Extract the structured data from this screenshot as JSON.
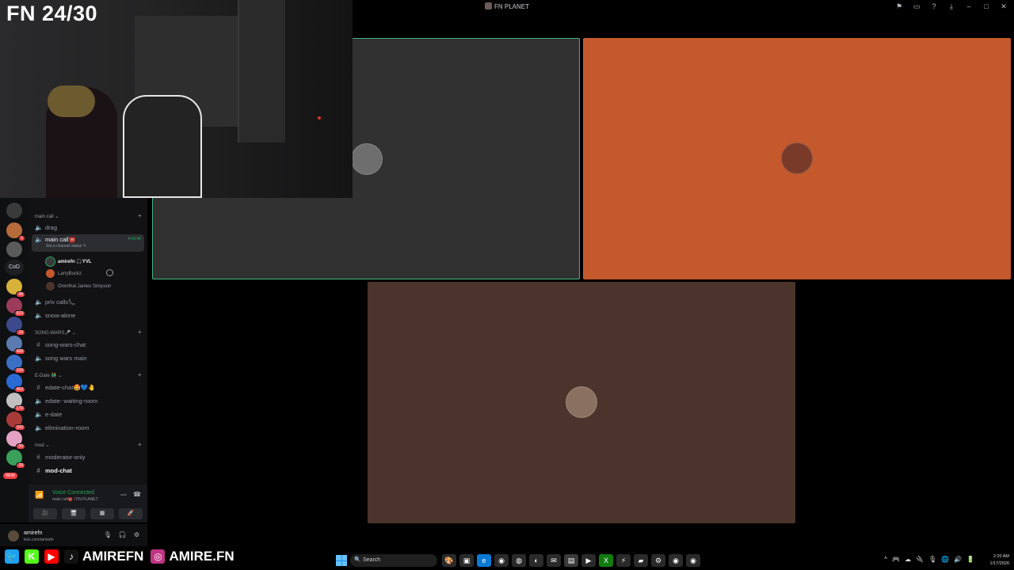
{
  "window": {
    "title": "FN PLANET",
    "controls": [
      "⚑",
      "▭",
      "?",
      "⤓",
      "–",
      "□",
      "✕"
    ]
  },
  "overlay": {
    "counter": "FN 24/30"
  },
  "guilds": [
    {
      "color": "#3a3a3a",
      "badge": ""
    },
    {
      "color": "#b56b3a",
      "badge": "1"
    },
    {
      "color": "#5b5b5b",
      "badge": ""
    },
    {
      "text": "CoD"
    },
    {
      "color": "#d7b23a",
      "badge": "46"
    },
    {
      "color": "#9c3b5a",
      "badge": "823"
    },
    {
      "color": "#3b4a8c",
      "badge": "10"
    },
    {
      "color": "#5a7ab0",
      "badge": "489"
    },
    {
      "color": "#3a6fc4",
      "badge": "169"
    },
    {
      "color": "#2a6ad4",
      "badge": "463"
    },
    {
      "color": "#c0c0c0",
      "badge": "176"
    },
    {
      "color": "#a83a3a",
      "badge": "103"
    },
    {
      "color": "#e4a3c4",
      "badge": "20"
    },
    {
      "color": "#3aa05a",
      "badge": "29"
    }
  ],
  "new_pill": "NEW",
  "categories": {
    "main_call": "main call",
    "song_wars": "SONG-WARS🎤",
    "edate": "E-Date 👬",
    "mod": "mod"
  },
  "channels": {
    "drag": "drag",
    "main_call": "main call☎️",
    "main_call_time": "4:43:46",
    "main_call_status": "Set a channel status ✎",
    "priv_calls": "priv calls📞",
    "snow_alone": "snow-alone",
    "song_wars_chat": "song-wars-chat",
    "song_wars_main": "song wars main",
    "edate_chat": "edate-chat🤩💙🤚",
    "edate_waiting": "edate- waiting-room",
    "e_date": "e-date",
    "elimination": "elimination-room",
    "moderator_only": "moderator-only",
    "mod_chat": "mod-chat"
  },
  "members": [
    {
      "name": "amirefn 🎧YVL",
      "color": "#3a3a3a",
      "speaking": true,
      "white": true
    },
    {
      "name": "LarryBuckz",
      "color": "#c3592c",
      "speaking": false,
      "white": false
    },
    {
      "name": "Orenthal James Simpson",
      "color": "#4b342b",
      "speaking": false,
      "white": false
    }
  ],
  "voice": {
    "title": "Voice Connected",
    "sub": "main call☎️ / FN PLANET",
    "actions": [
      "〰",
      "☎"
    ],
    "buttons": [
      "🎥",
      "🖥",
      "▦",
      "🚀"
    ]
  },
  "user": {
    "name": "amirefn",
    "status": "kick.com/amirefn",
    "controls": [
      "🎙",
      "🎧",
      "⚙"
    ]
  },
  "tiles": [
    {
      "name": "amirefn",
      "avatar": "#6e6e6e"
    },
    {
      "name": "LarryBuckz",
      "avatar": "#7a3a2a"
    },
    {
      "name": "Orenthal James Simpson",
      "avatar": "#8a7060"
    }
  ],
  "social": {
    "handle1": "AMIREFN",
    "handle2": "AMIRE.FN",
    "icons": [
      {
        "glyph": "🐦",
        "color": "#1da1f2"
      },
      {
        "glyph": "K",
        "color": "#53fc18"
      },
      {
        "glyph": "▶",
        "color": "#ff0000"
      },
      {
        "glyph": "♪",
        "color": "#111111"
      },
      {
        "glyph": "◎",
        "color": "#c13584"
      }
    ]
  },
  "taskbar": {
    "search": "Search",
    "time": "2:20 AM",
    "date": "1/17/2026",
    "apps": [
      {
        "glyph": "🎨",
        "color": "#2a2a2a"
      },
      {
        "glyph": "▣",
        "color": "#2a2a2a"
      },
      {
        "glyph": "e",
        "color": "#0a7ad6"
      },
      {
        "glyph": "◉",
        "color": "#2a2a2a"
      },
      {
        "glyph": "◍",
        "color": "#2a2a2a"
      },
      {
        "glyph": "◐",
        "color": "#2a2a2a"
      },
      {
        "glyph": "✉",
        "color": "#2a2a2a"
      },
      {
        "glyph": "▤",
        "color": "#3a3a3a"
      },
      {
        "glyph": "▶",
        "color": "#2a2a2a"
      },
      {
        "glyph": "X",
        "color": "#107c10"
      },
      {
        "glyph": "⚡",
        "color": "#2a2a2a"
      },
      {
        "glyph": "▰",
        "color": "#2a2a2a"
      },
      {
        "glyph": "⚙",
        "color": "#2a2a2a"
      },
      {
        "glyph": "◉",
        "color": "#2a2a2a"
      },
      {
        "glyph": "◉",
        "color": "#2a2a2a"
      }
    ],
    "tray": [
      "^",
      "🎮",
      "☁",
      "🔌",
      "🎙",
      "🌐",
      "🔊",
      "🔋"
    ]
  }
}
